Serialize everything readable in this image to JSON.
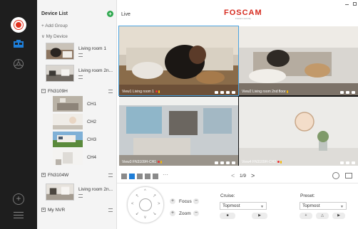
{
  "panel": {
    "title": "Device List",
    "add_group": "+ Add Group",
    "my_device": "∨ My Device",
    "devices": [
      {
        "label": "Living room 1"
      },
      {
        "label": "Living room 2n..."
      }
    ],
    "group_fn3109h": {
      "label": "FN3109H",
      "toggle": "−"
    },
    "channels": [
      {
        "label": "CH1"
      },
      {
        "label": "CH2"
      },
      {
        "label": "CH3"
      },
      {
        "label": "CH4"
      }
    ],
    "group_fn3104w": {
      "label": "FN3104W",
      "toggle": "+"
    },
    "device3": {
      "label": "Living room 2n..."
    },
    "group_nvr": {
      "label": "My NVR",
      "toggle": "+"
    }
  },
  "topbar": {
    "section": "Live",
    "brand": "FOSCAM",
    "brand_sub": "Foscam security"
  },
  "tiles": [
    {
      "caption": "View1 Living room 1"
    },
    {
      "caption": "View2 Living room 2nd floor"
    },
    {
      "caption": "View3 FN3109H-CH1"
    },
    {
      "caption": "View4 FN3109H-CH2"
    }
  ],
  "toolbar": {
    "more": "···",
    "prev": "<",
    "page": "1/9",
    "next": ">"
  },
  "controls": {
    "focus_label": "Focus",
    "zoom_label": "Zoom",
    "plus": "+",
    "minus": "−",
    "cruise_label": "Cruise:",
    "cruise_value": "Topmost",
    "preset_label": "Preset:",
    "preset_value": "Topmost"
  },
  "colors": {
    "brand": "#d62b1f",
    "accent": "#1e7ed8",
    "online": "#2fa84f"
  }
}
